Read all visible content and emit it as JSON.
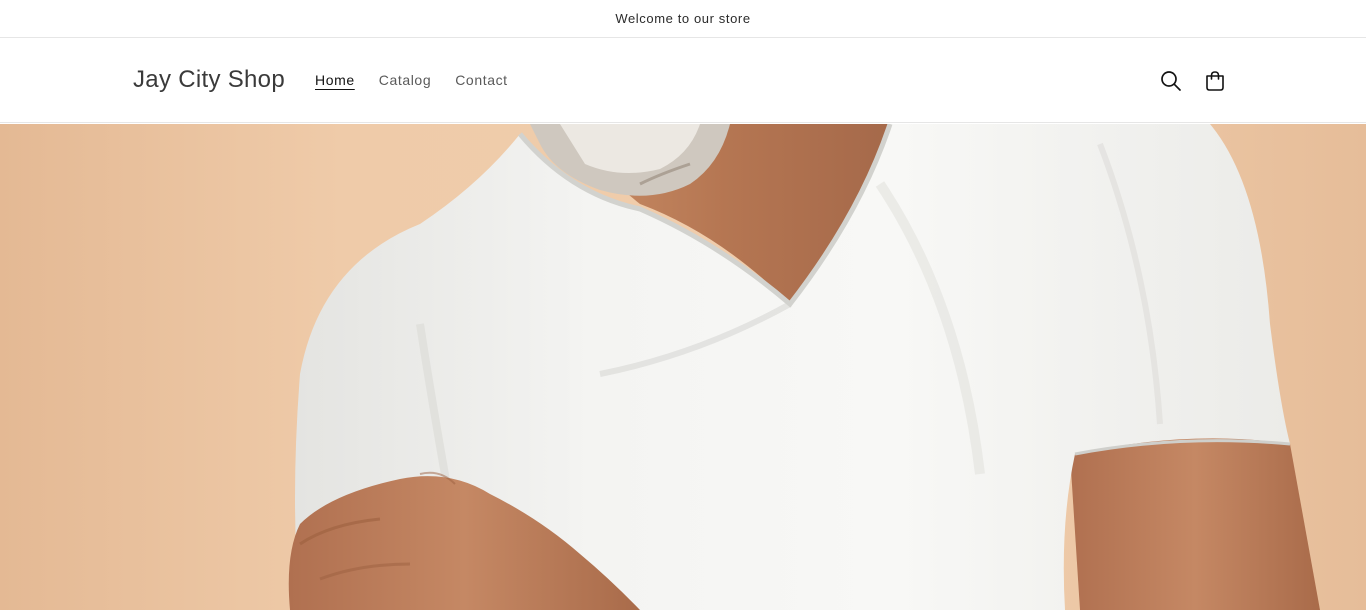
{
  "announcement": {
    "text": "Welcome to our store"
  },
  "header": {
    "logo": "Jay City Shop",
    "nav": [
      {
        "label": "Home",
        "active": true
      },
      {
        "label": "Catalog",
        "active": false
      },
      {
        "label": "Contact",
        "active": false
      }
    ],
    "icons": {
      "search": "search-icon",
      "cart": "cart-icon"
    }
  },
  "hero": {
    "image": "man-in-white-v-neck-tshirt-photo"
  },
  "colors": {
    "wall": "#efcaa7",
    "shirt": "#f3f3f1",
    "skin": "#b97a56",
    "beard": "#d8d3cc"
  }
}
